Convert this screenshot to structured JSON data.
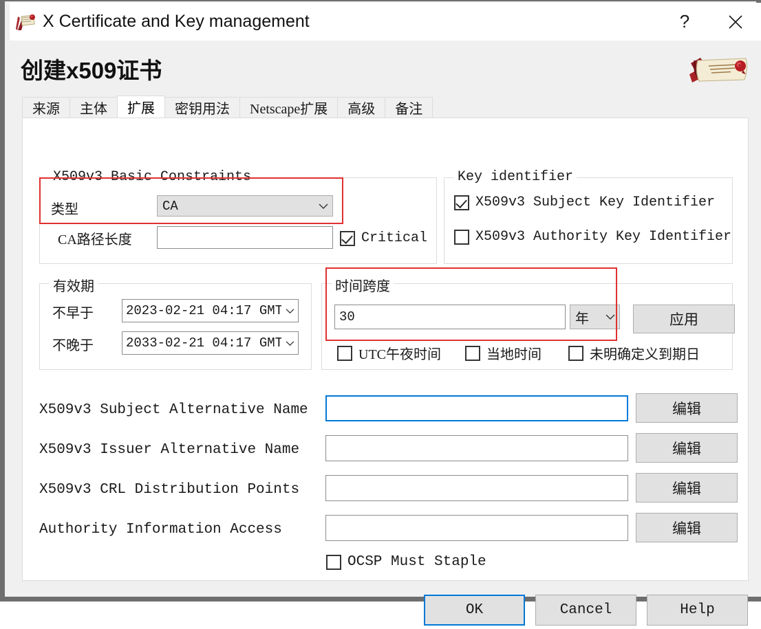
{
  "window": {
    "title": "X Certificate and Key management",
    "app_icon": "certificate-scroll-icon",
    "help_label": "?",
    "close_label": "✕"
  },
  "dialog": {
    "heading": "创建x509证书",
    "watermark": "certificate-scroll-ribbon-logo"
  },
  "tabs": [
    {
      "label": "来源",
      "active": false
    },
    {
      "label": "主体",
      "active": false
    },
    {
      "label": "扩展",
      "active": true
    },
    {
      "label": "密钥用法",
      "active": false
    },
    {
      "label": "Netscape扩展",
      "active": false
    },
    {
      "label": "高级",
      "active": false
    },
    {
      "label": "备注",
      "active": false
    }
  ],
  "basic_constraints": {
    "legend": "X509v3 Basic Constraints",
    "type_label": "类型",
    "type_value": "CA",
    "path_len_label": "CA路径长度",
    "path_len_value": "",
    "critical_label": "Critical",
    "critical_checked": true
  },
  "key_identifier": {
    "legend": "Key identifier",
    "subject_key_id_label": "X509v3 Subject Key Identifier",
    "subject_key_id_checked": true,
    "authority_key_id_label": "X509v3 Authority Key Identifier",
    "authority_key_id_checked": false
  },
  "validity": {
    "legend": "有效期",
    "not_before_label": "不早于",
    "not_before_value": "2023-02-21 04:17 GMT",
    "not_after_label": "不晚于",
    "not_after_value": "2033-02-21 04:17 GMT"
  },
  "timespan": {
    "legend": "时间跨度",
    "value": "30",
    "unit": "年",
    "apply_label": "应用",
    "midnight_utc_label": "UTC午夜时间",
    "midnight_utc_checked": false,
    "local_time_label": "当地时间",
    "local_time_checked": false,
    "no_well_defined_expiration_label": "未明确定义到期日",
    "no_well_defined_expiration_checked": false
  },
  "extensions": {
    "edit_label": "编辑",
    "rows": [
      {
        "label": "X509v3 Subject Alternative Name",
        "value": "",
        "focused": true
      },
      {
        "label": "X509v3 Issuer Alternative Name",
        "value": "",
        "focused": false
      },
      {
        "label": "X509v3 CRL Distribution Points",
        "value": "",
        "focused": false
      },
      {
        "label": "Authority Information Access",
        "value": "",
        "focused": false
      }
    ],
    "ocsp_label": "OCSP Must Staple",
    "ocsp_checked": false
  },
  "buttons": {
    "ok": "OK",
    "cancel": "Cancel",
    "help": "Help"
  },
  "colors": {
    "accent": "#0078d7",
    "annotation": "#e03030",
    "window_frame": "#6e6e6e",
    "dialog_bg": "#f0f0f0",
    "panel_bg": "#ffffff"
  }
}
